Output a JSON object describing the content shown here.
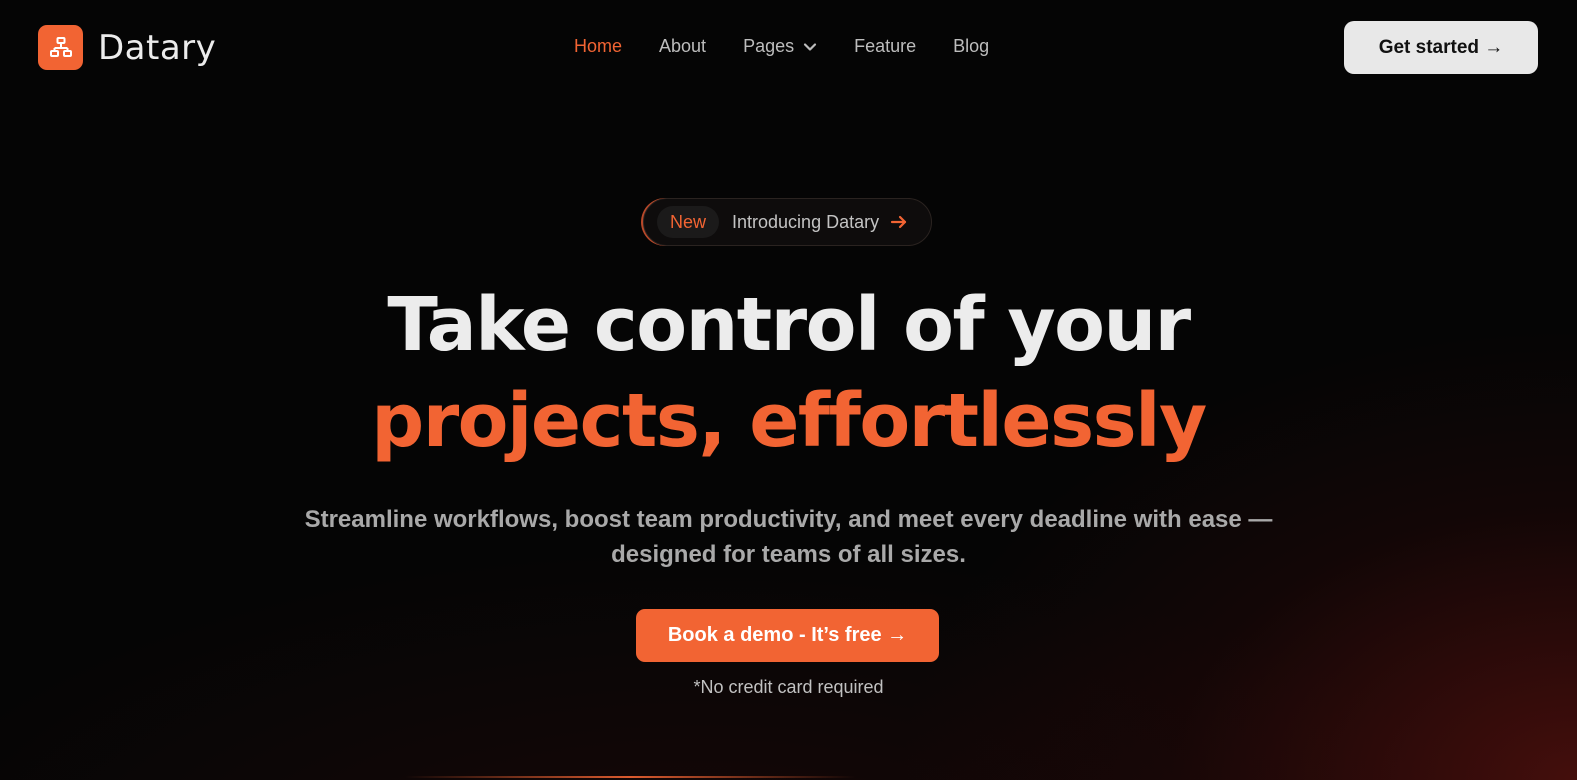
{
  "brand": {
    "name": "Datary",
    "logo_icon": "sitemap-icon",
    "accent": "#f26433"
  },
  "nav": {
    "items": [
      {
        "label": "Home",
        "active": true
      },
      {
        "label": "About"
      },
      {
        "label": "Pages",
        "has_dropdown": true
      },
      {
        "label": "Feature"
      },
      {
        "label": "Blog"
      }
    ],
    "cta_label": "Get started →"
  },
  "hero": {
    "badge": {
      "tag": "New",
      "text": "Introducing Datary"
    },
    "headline_line1": "Take control of your",
    "headline_line2": "projects, effortlessly",
    "subtitle_line1": "Streamline workflows, boost team productivity, and meet every deadline with ease —",
    "subtitle_line2": "designed for teams of all sizes.",
    "cta_label": "Book a demo - It’s free →",
    "note": "*No credit card required"
  }
}
